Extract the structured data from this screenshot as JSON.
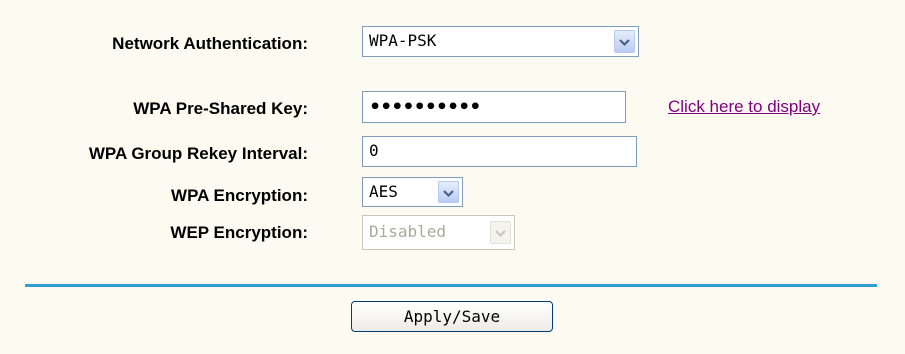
{
  "form": {
    "network_auth": {
      "label": "Network Authentication:",
      "value": "WPA-PSK"
    },
    "psk": {
      "label": "WPA Pre-Shared Key:",
      "value": "••••••••••",
      "display_link": "Click here to display"
    },
    "rekey": {
      "label": "WPA Group Rekey Interval:",
      "value": "0"
    },
    "wpa_encryption": {
      "label": "WPA Encryption:",
      "value": "AES"
    },
    "wep_encryption": {
      "label": "WEP Encryption:",
      "value": "Disabled"
    }
  },
  "actions": {
    "apply_label": "Apply/Save"
  },
  "colors": {
    "background": "#fdfbf1",
    "divider": "#2e9ed3",
    "link": "#800080"
  }
}
